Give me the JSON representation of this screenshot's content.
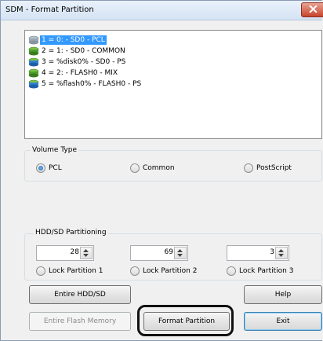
{
  "window": {
    "title": "SDM - Format Partition"
  },
  "partitions": {
    "items": [
      {
        "label": "1 = 0: - SD0 - PCL",
        "selected": true
      },
      {
        "label": "2 = 1: - SD0 - COMMON",
        "selected": false
      },
      {
        "label": "3 = %disk0% - SD0 - PS",
        "selected": false
      },
      {
        "label": "4 = 2: - FLASH0 - MIX",
        "selected": false
      },
      {
        "label": "5 = %flash0% - FLASH0 - PS",
        "selected": false
      }
    ]
  },
  "volume_type": {
    "label": "Volume Type",
    "options": [
      {
        "label": "PCL",
        "checked": true
      },
      {
        "label": "Common",
        "checked": false
      },
      {
        "label": "PostScript",
        "checked": false
      }
    ]
  },
  "partitioning": {
    "label": "HDD/SD Partitioning",
    "values": [
      "28",
      "69",
      "3"
    ],
    "locks": [
      "Lock Partition 1",
      "Lock Partition 2",
      "Lock Partition 3"
    ]
  },
  "buttons": {
    "entire_hdd": "Entire HDD/SD",
    "help": "Help",
    "entire_flash": "Entire Flash Memory",
    "format_partition": "Format Partition",
    "exit": "Exit"
  },
  "colors": {
    "selection": "#3399ff",
    "title_bg": "#dbe8f7",
    "close": "#c7452d"
  }
}
